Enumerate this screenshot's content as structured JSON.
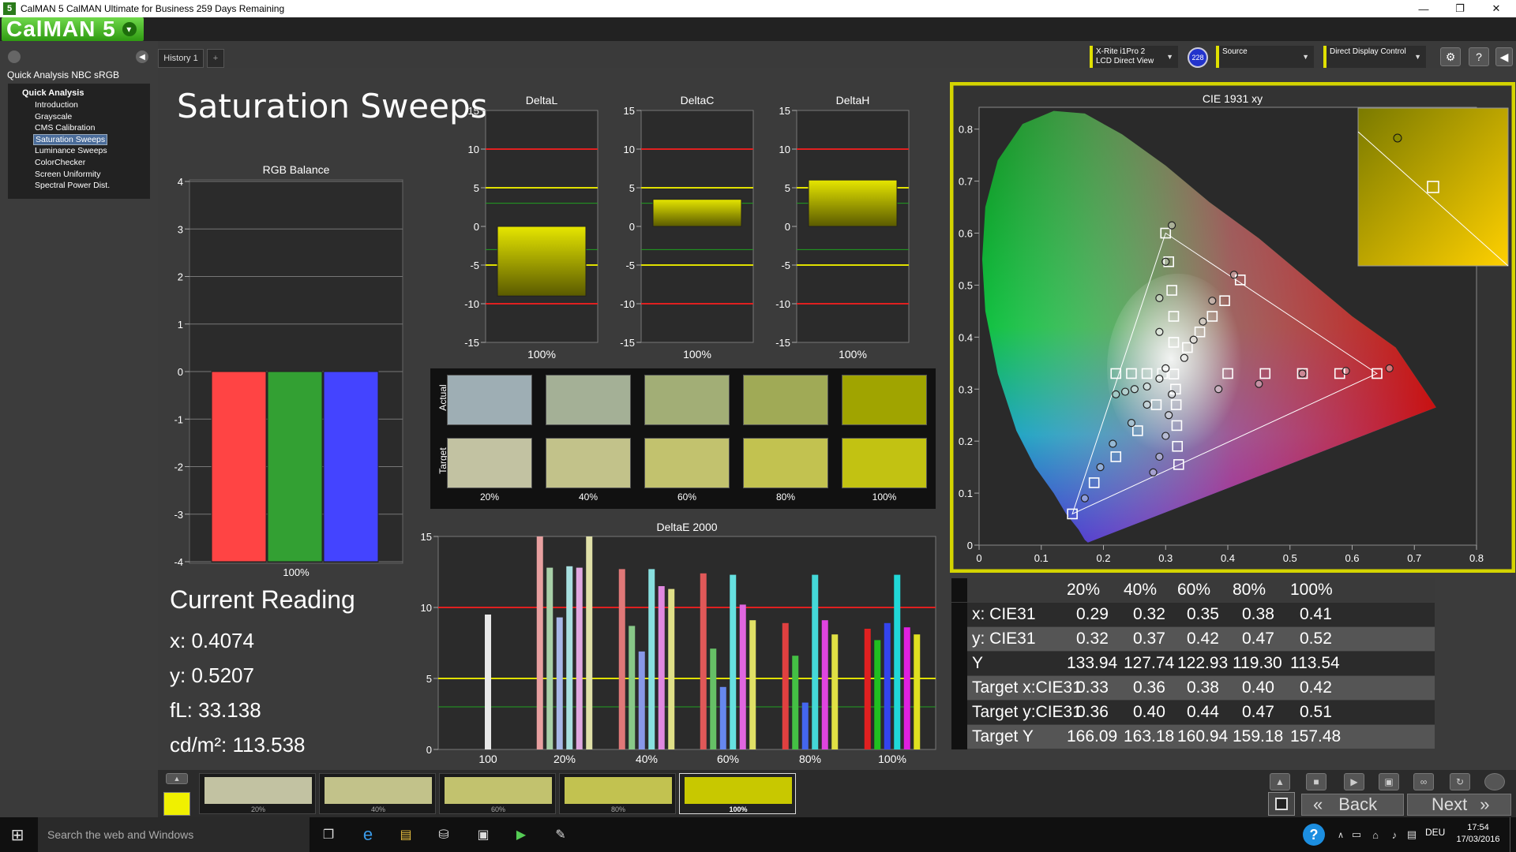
{
  "window": {
    "title": "CalMAN 5 CalMAN Ultimate for Business 259 Days Remaining",
    "app_icon": "5",
    "controls": [
      "—",
      "❐",
      "✕"
    ]
  },
  "logo": {
    "text": "CalMAN 5"
  },
  "left_panel": {
    "title": "Quick Analysis NBC sRGB",
    "tree_root": "Quick Analysis",
    "items": [
      "Introduction",
      "Grayscale",
      "CMS Calibration",
      "Saturation Sweeps",
      "Luminance Sweeps",
      "ColorChecker",
      "Screen Uniformity",
      "Spectral Power Dist."
    ],
    "selected_index": 3
  },
  "tabs": {
    "history": "History 1",
    "add": "+"
  },
  "devices": {
    "meter_line1": "X-Rite i1Pro 2",
    "meter_line2": "LCD Direct View",
    "meter_badge": "228",
    "source": "Source",
    "display": "Direct Display Control"
  },
  "page_title": "Saturation Sweeps",
  "rgb_balance": {
    "title": "RGB Balance",
    "ticks": [
      "4",
      "3",
      "2",
      "1",
      "0",
      "-1",
      "-2",
      "-3",
      "-4"
    ],
    "xlabel": "100%",
    "values": {
      "r": -4,
      "g": -4,
      "b": -4
    },
    "colors": {
      "r": "#ff4444",
      "g": "#33a033",
      "b": "#4444ff"
    }
  },
  "delta_charts": [
    {
      "title": "DeltaL",
      "xlabel": "100%",
      "value": -9
    },
    {
      "title": "DeltaC",
      "xlabel": "100%",
      "value": 3.5
    },
    {
      "title": "DeltaH",
      "xlabel": "100%",
      "value": 6
    }
  ],
  "delta_ticks": [
    "15",
    "10",
    "5",
    "0",
    "-5",
    "-10",
    "-15"
  ],
  "swatches": {
    "actual_label": "Actual",
    "target_label": "Target",
    "labels": [
      "20%",
      "40%",
      "60%",
      "80%",
      "100%"
    ],
    "actual_colors": [
      "#9eaeb4",
      "#a4b096",
      "#a2ae76",
      "#a0aa56",
      "#a0a400"
    ],
    "target_colors": [
      "#c2c2a2",
      "#c2c28a",
      "#c2c26e",
      "#c2c250",
      "#c2c212"
    ]
  },
  "deltae": {
    "title": "DeltaE 2000",
    "yticks": [
      "15",
      "10",
      "5",
      "0"
    ],
    "xlabels": [
      "100",
      "20%",
      "40%",
      "60%",
      "80%",
      "100%"
    ],
    "groups": [
      {
        "bars": [
          {
            "v": 9.5,
            "c": "#e8e8e8"
          }
        ]
      },
      {
        "bars": [
          {
            "v": 15,
            "c": "#e8a0a0"
          },
          {
            "v": 12.8,
            "c": "#a8d0a8"
          },
          {
            "v": 9.3,
            "c": "#a8b8e8"
          },
          {
            "v": 12.9,
            "c": "#a8e0e0"
          },
          {
            "v": 12.8,
            "c": "#e0a8e0"
          },
          {
            "v": 15,
            "c": "#e0e0a8"
          }
        ]
      },
      {
        "bars": [
          {
            "v": 12.7,
            "c": "#e07878"
          },
          {
            "v": 8.7,
            "c": "#88c888"
          },
          {
            "v": 6.9,
            "c": "#8898e8"
          },
          {
            "v": 12.7,
            "c": "#88e0e0"
          },
          {
            "v": 11.5,
            "c": "#e088e0"
          },
          {
            "v": 11.3,
            "c": "#e0e088"
          }
        ]
      },
      {
        "bars": [
          {
            "v": 12.4,
            "c": "#e05858"
          },
          {
            "v": 7.1,
            "c": "#66c066"
          },
          {
            "v": 4.4,
            "c": "#6688ee"
          },
          {
            "v": 12.3,
            "c": "#66e0e0"
          },
          {
            "v": 10.2,
            "c": "#e066e0"
          },
          {
            "v": 9.1,
            "c": "#e0e066"
          }
        ]
      },
      {
        "bars": [
          {
            "v": 8.9,
            "c": "#e04040"
          },
          {
            "v": 6.6,
            "c": "#44c044"
          },
          {
            "v": 3.3,
            "c": "#4466ee"
          },
          {
            "v": 12.3,
            "c": "#44d8d8"
          },
          {
            "v": 9.1,
            "c": "#e044e0"
          },
          {
            "v": 8.1,
            "c": "#e0e044"
          }
        ]
      },
      {
        "bars": [
          {
            "v": 8.5,
            "c": "#e02020"
          },
          {
            "v": 7.7,
            "c": "#20c020"
          },
          {
            "v": 8.9,
            "c": "#3344ee"
          },
          {
            "v": 12.3,
            "c": "#20d8d8"
          },
          {
            "v": 8.6,
            "c": "#e020e0"
          },
          {
            "v": 8.1,
            "c": "#e0e020"
          }
        ]
      }
    ]
  },
  "cie": {
    "title": "CIE 1931 xy",
    "xticks": [
      "0",
      "0.1",
      "0.2",
      "0.3",
      "0.4",
      "0.5",
      "0.6",
      "0.7",
      "0.8"
    ],
    "yticks": [
      "0",
      "0.1",
      "0.2",
      "0.3",
      "0.4",
      "0.5",
      "0.6",
      "0.7",
      "0.8"
    ],
    "border_color": "#d4d400"
  },
  "current_reading": {
    "title": "Current Reading",
    "x": "x: 0.4074",
    "y": "y: 0.5207",
    "fl": "fL: 33.138",
    "cdm2": "cd/m²: 113.538"
  },
  "data_table": {
    "headers": [
      "20%",
      "40%",
      "60%",
      "80%",
      "100%"
    ],
    "rows": [
      {
        "label": "x: CIE31",
        "values": [
          "0.29",
          "0.32",
          "0.35",
          "0.38",
          "0.41"
        ]
      },
      {
        "label": "y: CIE31",
        "values": [
          "0.32",
          "0.37",
          "0.42",
          "0.47",
          "0.52"
        ]
      },
      {
        "label": "Y",
        "values": [
          "133.94",
          "127.74",
          "122.93",
          "119.30",
          "113.54"
        ]
      },
      {
        "label": "Target x:CIE31",
        "values": [
          "0.33",
          "0.36",
          "0.38",
          "0.40",
          "0.42"
        ]
      },
      {
        "label": "Target y:CIE31",
        "values": [
          "0.36",
          "0.40",
          "0.44",
          "0.47",
          "0.51"
        ]
      },
      {
        "label": "Target Y",
        "values": [
          "166.09",
          "163.18",
          "160.94",
          "159.18",
          "157.48"
        ]
      }
    ]
  },
  "bottom_swatches": {
    "current_color": "#f0f000",
    "items": [
      {
        "label": "20%",
        "color": "#c2c2a2"
      },
      {
        "label": "40%",
        "color": "#c2c28a"
      },
      {
        "label": "60%",
        "color": "#c2c26e"
      },
      {
        "label": "80%",
        "color": "#c2c250"
      },
      {
        "label": "100%",
        "color": "#c2c212"
      }
    ]
  },
  "nav": {
    "back": "Back",
    "next": "Next"
  },
  "taskbar": {
    "search_placeholder": "Search the web and Windows",
    "lang": "DEU",
    "time": "17:54",
    "date": "17/03/2016"
  }
}
